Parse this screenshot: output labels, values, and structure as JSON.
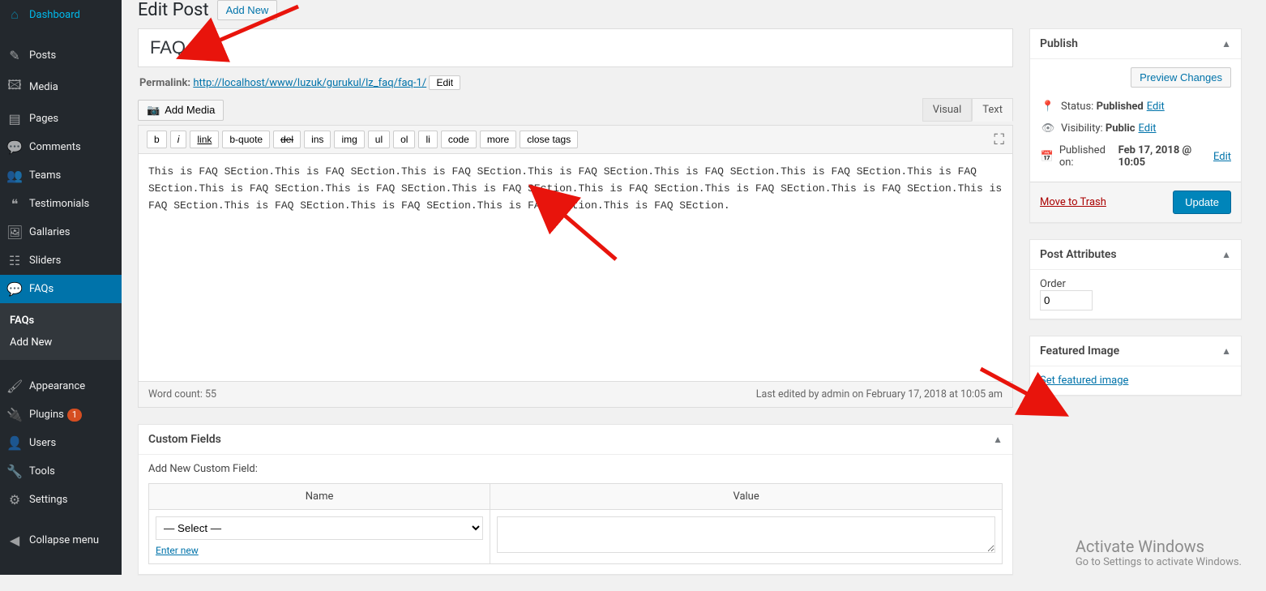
{
  "sidebar": {
    "items": [
      {
        "icon": "⌂",
        "label": "Dashboard"
      },
      {
        "icon": "✎",
        "label": "Posts"
      },
      {
        "icon": "🖾",
        "label": "Media"
      },
      {
        "icon": "▤",
        "label": "Pages"
      },
      {
        "icon": "💬",
        "label": "Comments"
      },
      {
        "icon": "👥",
        "label": "Teams"
      },
      {
        "icon": "❝",
        "label": "Testimonials"
      },
      {
        "icon": "🖼",
        "label": "Gallaries"
      },
      {
        "icon": "☷",
        "label": "Sliders"
      },
      {
        "icon": "💬",
        "label": "FAQs"
      }
    ],
    "submenu": [
      "FAQs",
      "Add New"
    ],
    "items2": [
      {
        "icon": "🖌",
        "label": "Appearance"
      },
      {
        "icon": "🔌",
        "label": "Plugins",
        "badge": "1"
      },
      {
        "icon": "👤",
        "label": "Users"
      },
      {
        "icon": "🔧",
        "label": "Tools"
      },
      {
        "icon": "⚙",
        "label": "Settings"
      }
    ],
    "collapse_icon": "◀",
    "collapse": "Collapse menu"
  },
  "heading": {
    "title": "Edit Post",
    "add_new": "Add New"
  },
  "post": {
    "title": "FAQ 1",
    "permalink_label": "Permalink:",
    "permalink_url": "http://localhost/www/luzuk/gurukul/lz_faq/faq-1/",
    "edit": "Edit",
    "add_media": "Add Media",
    "tab_visual": "Visual",
    "tab_text": "Text",
    "toolbar": {
      "b": "b",
      "i": "i",
      "link": "link",
      "bquote": "b-quote",
      "del": "del",
      "ins": "ins",
      "img": "img",
      "ul": "ul",
      "ol": "ol",
      "li": "li",
      "code": "code",
      "more": "more",
      "close": "close tags"
    },
    "body": "This is FAQ SEction.This is FAQ SEction.This is FAQ SEction.This is FAQ SEction.This is FAQ SEction.This is FAQ SEction.This is FAQ SEction.This is FAQ SEction.This is FAQ SEction.This is FAQ SEction.This is FAQ SEction.This is FAQ SEction.This is FAQ SEction.This is FAQ SEction.This is FAQ SEction.This is FAQ SEction.This is FAQ SEction.This is FAQ SEction.",
    "word_count": "Word count: 55",
    "last_edited": "Last edited by admin on February 17, 2018 at 10:05 am"
  },
  "publish": {
    "title": "Publish",
    "preview": "Preview Changes",
    "status_label": "Status:",
    "status_value": "Published",
    "status_edit": "Edit",
    "visibility_label": "Visibility:",
    "visibility_value": "Public",
    "visibility_edit": "Edit",
    "published_label": "Published on:",
    "published_value": "Feb 17, 2018 @ 10:05",
    "published_edit": "Edit",
    "trash": "Move to Trash",
    "update": "Update"
  },
  "attributes": {
    "title": "Post Attributes",
    "order_label": "Order",
    "order_value": "0"
  },
  "featured": {
    "title": "Featured Image",
    "link": "Set featured image"
  },
  "custom_fields": {
    "title": "Custom Fields",
    "add_label": "Add New Custom Field:",
    "name": "Name",
    "value": "Value",
    "select": "— Select —",
    "enter_new": "Enter new"
  },
  "watermark": {
    "line1": "Activate Windows",
    "line2": "Go to Settings to activate Windows."
  }
}
